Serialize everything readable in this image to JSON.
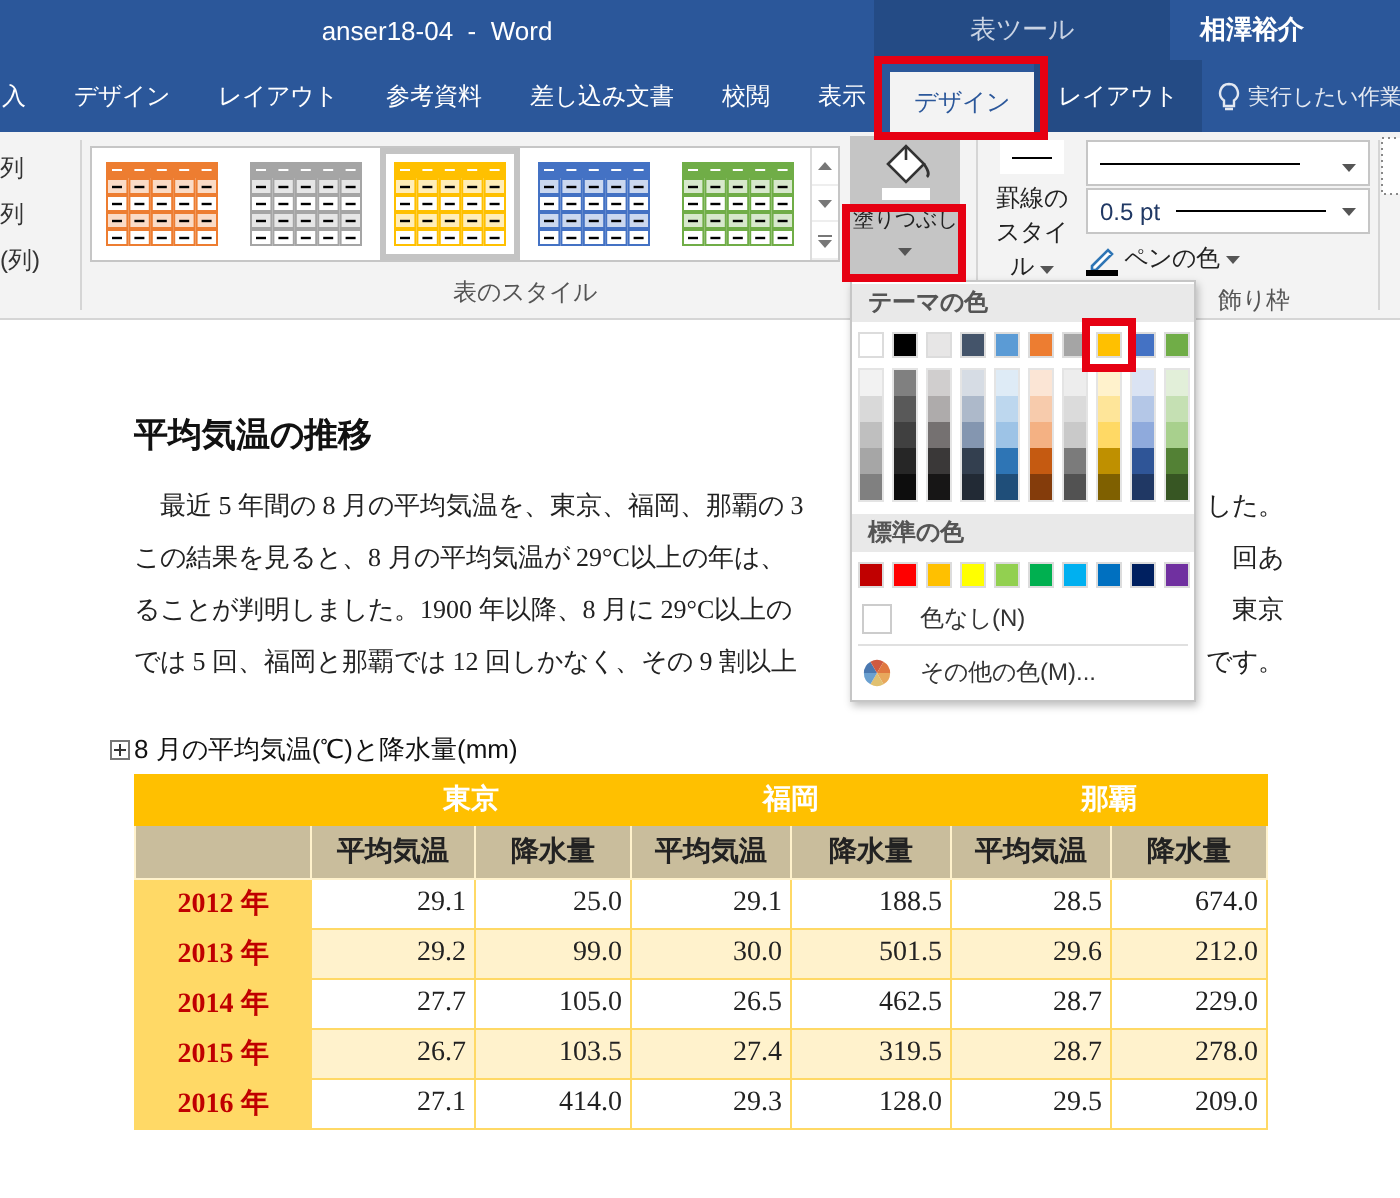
{
  "window": {
    "title": "anser18-04  -  Word",
    "context_title": "表ツール",
    "user": "相澤裕介"
  },
  "tabs": [
    {
      "label": "入",
      "selected": false,
      "contextual": false,
      "highlighted": false
    },
    {
      "label": "デザイン",
      "selected": false,
      "contextual": false,
      "highlighted": false
    },
    {
      "label": "レイアウト",
      "selected": false,
      "contextual": false,
      "highlighted": false
    },
    {
      "label": "参考資料",
      "selected": false,
      "contextual": false,
      "highlighted": false
    },
    {
      "label": "差し込み文書",
      "selected": false,
      "contextual": false,
      "highlighted": false
    },
    {
      "label": "校閲",
      "selected": false,
      "contextual": false,
      "highlighted": false
    },
    {
      "label": "表示",
      "selected": false,
      "contextual": false,
      "highlighted": false
    },
    {
      "label": "デザイン",
      "selected": true,
      "contextual": true,
      "highlighted": true
    },
    {
      "label": "レイアウト",
      "selected": false,
      "contextual": true,
      "highlighted": false
    }
  ],
  "tell_me": "実行したい作業",
  "ribbon": {
    "left_options": [
      "列",
      "列",
      "(列)"
    ],
    "table_styles": [
      {
        "color": "#ed7d31",
        "selected": false
      },
      {
        "color": "#a5a5a5",
        "selected": false
      },
      {
        "color": "#ffc000",
        "selected": true
      },
      {
        "color": "#4472c4",
        "selected": false
      },
      {
        "color": "#70ad47",
        "selected": false
      }
    ],
    "table_styles_label": "表のスタイル",
    "fill_button": {
      "label": "塗りつぶし",
      "pressed": true,
      "highlighted": true
    },
    "border_style": [
      "罫線の",
      "スタイル"
    ],
    "line_weight": "0.5 pt",
    "pen_color": "ペンの色",
    "borders_label": "飾り枠"
  },
  "color_menu": {
    "theme_header": "テーマの色",
    "theme_colors": [
      {
        "color": "#ffffff",
        "highlighted": false,
        "shades": [
          {
            "color": "#f2f2f2"
          },
          {
            "color": "#d9d9d9"
          },
          {
            "color": "#bfbfbf"
          },
          {
            "color": "#a6a6a6"
          },
          {
            "color": "#808080"
          }
        ]
      },
      {
        "color": "#000000",
        "highlighted": false,
        "shades": [
          {
            "color": "#808080"
          },
          {
            "color": "#595959"
          },
          {
            "color": "#404040"
          },
          {
            "color": "#262626"
          },
          {
            "color": "#0d0d0d"
          }
        ]
      },
      {
        "color": "#e7e6e6",
        "highlighted": false,
        "shades": [
          {
            "color": "#d0cece"
          },
          {
            "color": "#aeabab"
          },
          {
            "color": "#757171"
          },
          {
            "color": "#3a3838"
          },
          {
            "color": "#171616"
          }
        ]
      },
      {
        "color": "#44546a",
        "highlighted": false,
        "shades": [
          {
            "color": "#d6dce4"
          },
          {
            "color": "#adb9ca"
          },
          {
            "color": "#8496b0"
          },
          {
            "color": "#333f4f"
          },
          {
            "color": "#222a35"
          }
        ]
      },
      {
        "color": "#5b9bd5",
        "highlighted": false,
        "shades": [
          {
            "color": "#deebf6"
          },
          {
            "color": "#bdd7ee"
          },
          {
            "color": "#9dc3e6"
          },
          {
            "color": "#2e75b5"
          },
          {
            "color": "#1f4e79"
          }
        ]
      },
      {
        "color": "#ed7d31",
        "highlighted": false,
        "shades": [
          {
            "color": "#fbe5d5"
          },
          {
            "color": "#f7cbac"
          },
          {
            "color": "#f4b183"
          },
          {
            "color": "#c55a11"
          },
          {
            "color": "#843c0b"
          }
        ]
      },
      {
        "color": "#a5a5a5",
        "highlighted": false,
        "shades": [
          {
            "color": "#ededed"
          },
          {
            "color": "#dbdbdb"
          },
          {
            "color": "#c9c9c9"
          },
          {
            "color": "#7b7b7b"
          },
          {
            "color": "#525252"
          }
        ]
      },
      {
        "color": "#ffc000",
        "highlighted": true,
        "shades": [
          {
            "color": "#fff2cc"
          },
          {
            "color": "#fee599"
          },
          {
            "color": "#ffd965"
          },
          {
            "color": "#bf9000"
          },
          {
            "color": "#7f6000"
          }
        ]
      },
      {
        "color": "#4472c4",
        "highlighted": false,
        "shades": [
          {
            "color": "#dae3f3"
          },
          {
            "color": "#b4c7e7"
          },
          {
            "color": "#8faadc"
          },
          {
            "color": "#2f5597"
          },
          {
            "color": "#203864"
          }
        ]
      },
      {
        "color": "#70ad47",
        "highlighted": false,
        "shades": [
          {
            "color": "#e2efd9"
          },
          {
            "color": "#c5e0b3"
          },
          {
            "color": "#a8d08d"
          },
          {
            "color": "#538135"
          },
          {
            "color": "#375623"
          }
        ]
      }
    ],
    "standard_header": "標準の色",
    "standard_colors": [
      {
        "color": "#c00000"
      },
      {
        "color": "#ff0000"
      },
      {
        "color": "#ffc000"
      },
      {
        "color": "#ffff00"
      },
      {
        "color": "#92d050"
      },
      {
        "color": "#00b050"
      },
      {
        "color": "#00b0f0"
      },
      {
        "color": "#0070c0"
      },
      {
        "color": "#002060"
      },
      {
        "color": "#7030a0"
      }
    ],
    "no_color": "色なし(N)",
    "more_colors": "その他の色(M)..."
  },
  "document": {
    "heading": "平均気温の推移",
    "paragraph_lines": [
      {
        "left": "　最近 5 年間の 8 月の平均気温を、東京、福岡、那覇の 3",
        "right": "した。"
      },
      {
        "left": "この結果を見ると、8 月の平均気温が 29°C以上の年は、",
        "right": "回あ"
      },
      {
        "left": "ることが判明しました。1900 年以降、8 月に 29°C以上の",
        "right": "東京"
      },
      {
        "left": "では 5 回、福岡と那覇では 12 回しかなく、その 9 割以上",
        "right": "です。"
      }
    ],
    "caption": "8 月の平均気温(℃)と降水量(mm)",
    "table": {
      "cities": [
        "東京",
        "福岡",
        "那覇"
      ],
      "subheaders": [
        "平均気温",
        "降水量",
        "平均気温",
        "降水量",
        "平均気温",
        "降水量"
      ],
      "rows": [
        {
          "year": "2012 年",
          "values": [
            "29.1",
            "25.0",
            "29.1",
            "188.5",
            "28.5",
            "674.0"
          ]
        },
        {
          "year": "2013 年",
          "values": [
            "29.2",
            "99.0",
            "30.0",
            "501.5",
            "29.6",
            "212.0"
          ]
        },
        {
          "year": "2014 年",
          "values": [
            "27.7",
            "105.0",
            "26.5",
            "462.5",
            "28.7",
            "229.0"
          ]
        },
        {
          "year": "2015 年",
          "values": [
            "26.7",
            "103.5",
            "27.4",
            "319.5",
            "28.7",
            "278.0"
          ]
        },
        {
          "year": "2016 年",
          "values": [
            "27.1",
            "414.0",
            "29.3",
            "128.0",
            "29.5",
            "209.0"
          ]
        }
      ]
    }
  }
}
